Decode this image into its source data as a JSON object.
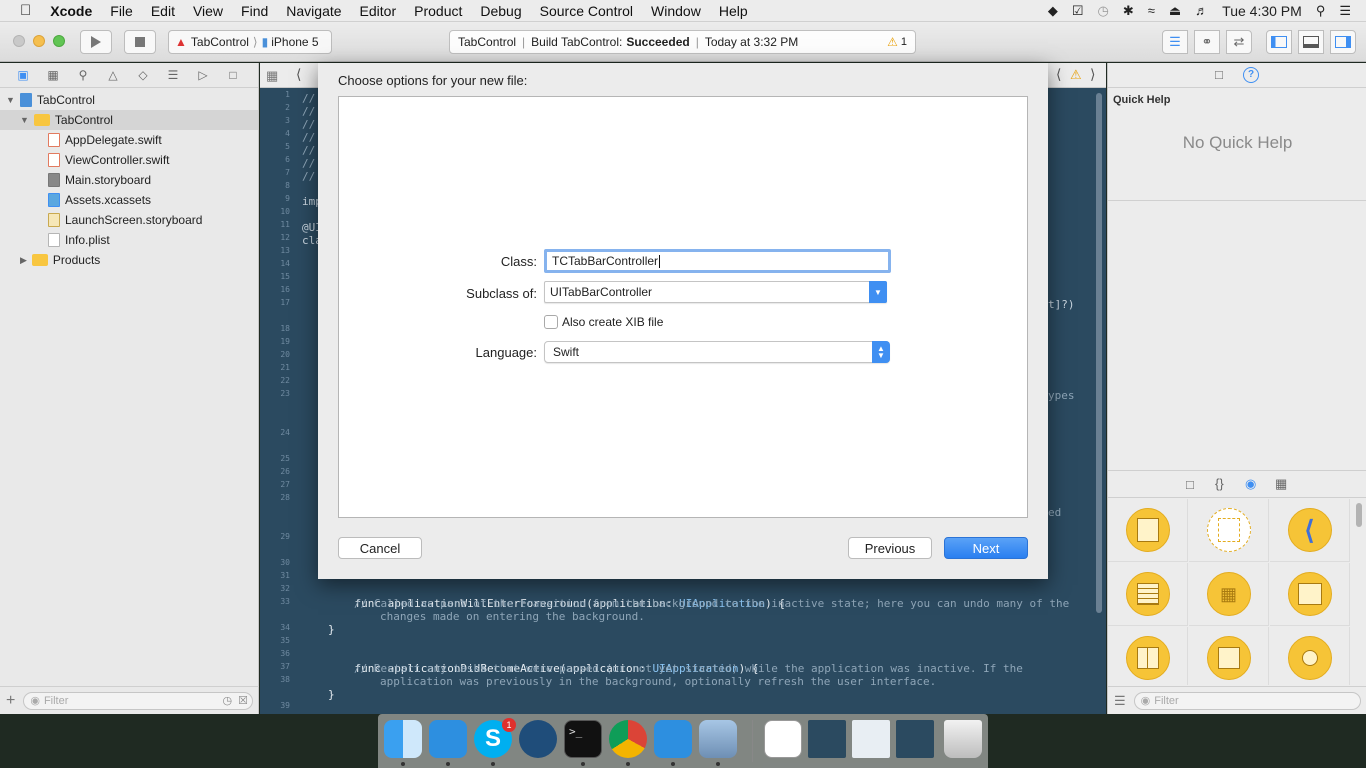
{
  "menubar": {
    "apple": "",
    "items": [
      "Xcode",
      "File",
      "Edit",
      "View",
      "Find",
      "Navigate",
      "Editor",
      "Product",
      "Debug",
      "Source Control",
      "Window",
      "Help"
    ],
    "clock": "Tue 4:30 PM"
  },
  "toolbar": {
    "scheme_project": "TabControl",
    "scheme_device": "iPhone 5",
    "activity_project": "TabControl",
    "activity_build_label": "Build TabControl:",
    "activity_build_status": "Succeeded",
    "activity_time": "Today at 3:32 PM",
    "warning_count": "1"
  },
  "navigator": {
    "project": "TabControl",
    "group": "TabControl",
    "files": [
      "AppDelegate.swift",
      "ViewController.swift",
      "Main.storyboard",
      "Assets.xcassets",
      "LaunchScreen.storyboard",
      "Info.plist"
    ],
    "products": "Products",
    "filter_placeholder": "Filter"
  },
  "editor": {
    "line_numbers": [
      "1",
      "2",
      "3",
      "4",
      "5",
      "6",
      "7",
      "8",
      "9",
      "10",
      "11",
      "12",
      "13",
      "14",
      "15",
      "16",
      "17",
      "18",
      "19",
      "20",
      "21",
      "22",
      "23",
      "24",
      "25",
      "26",
      "27",
      "28",
      "29",
      "30",
      "31",
      "32",
      "33",
      "34",
      "35",
      "36",
      "37",
      "38",
      "39"
    ],
    "lines": {
      "c1": "//",
      "c2": "//",
      "c3": "//",
      "c4": "//",
      "c5": "//",
      "c6": "//",
      "c7": "//",
      "imp": "imp",
      "ui": "@UI",
      "cla": "cla",
      "frag17": "t]?)",
      "frag23": "ypes",
      "frag28": "ed",
      "l32a": "func applicationWillEnterForeground(application: ",
      "l32b": "UIApplication",
      "l32c": ") {",
      "l33": "// Called as part of the transition from the background to the inactive state; here you can undo many of the",
      "l33b": "changes made on entering the background.",
      "l34": "}",
      "l36a": "func applicationDidBecomeActive(application: ",
      "l36b": "UIApplication",
      "l36c": ") {",
      "l37": "// Restart any tasks that were paused (or not yet started) while the application was inactive. If the",
      "l37b": "application was previously in the background, optionally refresh the user interface.",
      "l38": "}"
    }
  },
  "dialog": {
    "title": "Choose options for your new file:",
    "class_label": "Class:",
    "class_value": "TCTabBarController",
    "subclass_label": "Subclass of:",
    "subclass_value": "UITabBarController",
    "xib_label": "Also create XIB file",
    "language_label": "Language:",
    "language_value": "Swift",
    "cancel": "Cancel",
    "previous": "Previous",
    "next": "Next"
  },
  "utilities": {
    "quick_help_title": "Quick Help",
    "no_quick_help": "No Quick Help",
    "filter_placeholder": "Filter"
  },
  "dock": {
    "skype_badge": "1"
  },
  "colors": {
    "accent": "#3f8ff2",
    "editor_bg": "#2b4a60",
    "library_icon": "#f6c437"
  }
}
